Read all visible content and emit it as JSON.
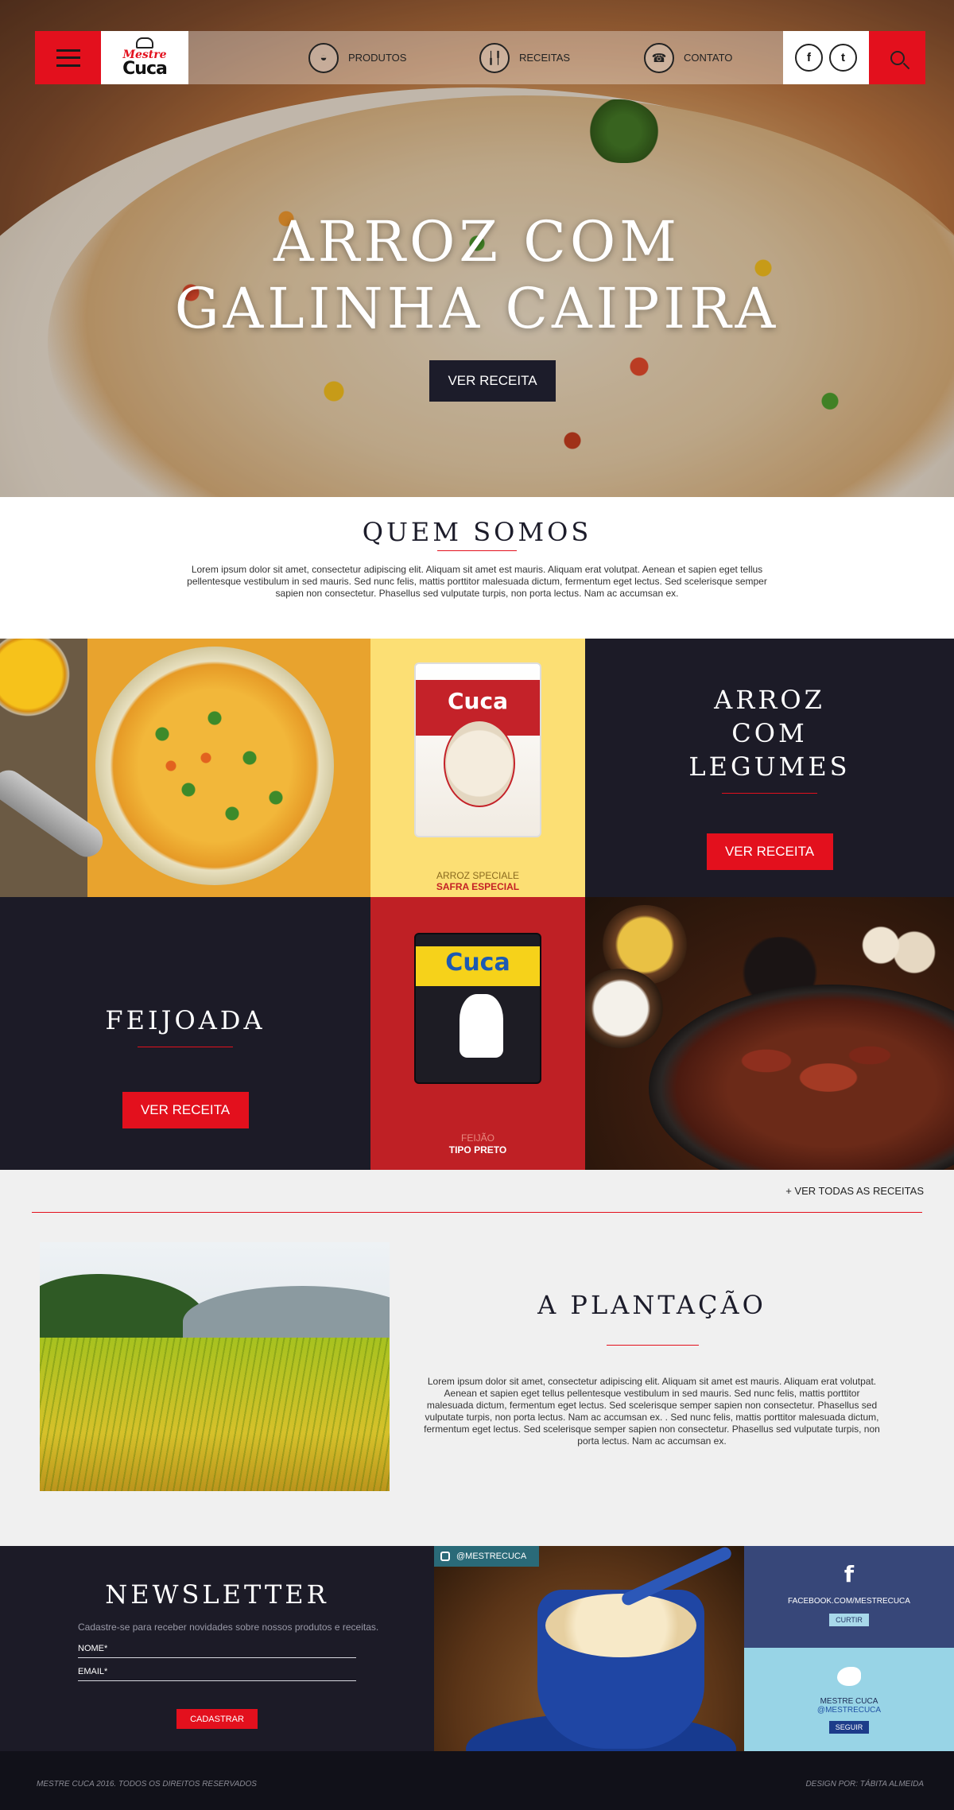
{
  "header": {
    "logo_top": "Mestre",
    "logo_bottom": "Cuca",
    "nav": [
      {
        "label": "PRODUTOS",
        "icon": "plate-icon"
      },
      {
        "label": "RECEITAS",
        "icon": "cutlery-icon"
      },
      {
        "label": "CONTATO",
        "icon": "phone-icon"
      }
    ],
    "social": [
      {
        "glyph": "f",
        "icon": "facebook-icon"
      },
      {
        "glyph": "t",
        "icon": "twitter-icon"
      }
    ]
  },
  "hero": {
    "title_line1": "ARROZ COM",
    "title_line2": "GALINHA CAIPIRA",
    "button": "VER RECEITA"
  },
  "about": {
    "title": "QUEM SOMOS",
    "text": "Lorem ipsum dolor sit amet, consectetur adipiscing elit. Aliquam sit amet est mauris. Aliquam erat volutpat. Aenean et sapien eget tellus pellentesque vestibulum in sed mauris. Sed nunc felis, mattis porttitor malesuada dictum, fermentum eget lectus. Sed scelerisque semper sapien non consectetur. Phasellus sed vulputate turpis, non porta lectus. Nam ac accumsan ex."
  },
  "products": [
    {
      "pack_brand": "Cuca",
      "line1": "ARROZ SPECIALE",
      "line2": "SAFRA ESPECIAL",
      "line1_color": "#8a6a1e",
      "line2_color": "#c41f25"
    },
    {
      "pack_brand": "Cuca",
      "line1": "FEIJÃO",
      "line2": "TIPO PRETO",
      "line1_color": "#e88a80",
      "line2_color": "#ffffff"
    }
  ],
  "recipes": [
    {
      "title_lines": [
        "ARROZ",
        "COM",
        "LEGUMES"
      ],
      "button": "VER RECEITA"
    },
    {
      "title_lines": [
        "FEIJOADA"
      ],
      "button": "VER RECEITA"
    }
  ],
  "all_recipes_link": "+ VER TODAS AS RECEITAS",
  "plantation": {
    "title": "A PLANTAÇÃO",
    "text": "Lorem ipsum dolor sit amet, consectetur adipiscing elit. Aliquam sit amet est mauris. Aliquam erat volutpat. Aenean et sapien eget tellus pellentesque vestibulum in sed mauris. Sed nunc felis, mattis porttitor malesuada dictum, fermentum eget lectus. Sed scelerisque semper sapien non consectetur. Phasellus sed vulputate turpis, non porta lectus. Nam ac accumsan ex. . Sed nunc felis, mattis porttitor malesuada dictum, fermentum eget lectus. Sed scelerisque semper sapien non consectetur. Phasellus sed vulputate turpis, non porta lectus. Nam ac accumsan ex."
  },
  "newsletter": {
    "title": "NEWSLETTER",
    "subtitle": "Cadastre-se para receber novidades sobre nossos produtos e receitas.",
    "name_label": "NOME*",
    "email_label": "EMAIL*",
    "submit": "CADASTRAR"
  },
  "instagram": {
    "handle": "@MESTRECUCA"
  },
  "facebook": {
    "glyph": "f",
    "text": "FACEBOOK.COM/MESTRECUCA",
    "button": "CURTIR"
  },
  "twitter": {
    "name": "MESTRE CUCA",
    "handle": "@MESTRECUCA",
    "button": "SEGUIR"
  },
  "footer": {
    "left": "MESTRE CUCA 2016. TODOS OS DIREITOS RESERVADOS",
    "right": "DESIGN POR: TÁBITA ALMEIDA"
  },
  "colors": {
    "accent": "#e3101d",
    "dark": "#1c1b27",
    "yellow": "#fcdf74",
    "product_red": "#bf2025"
  }
}
